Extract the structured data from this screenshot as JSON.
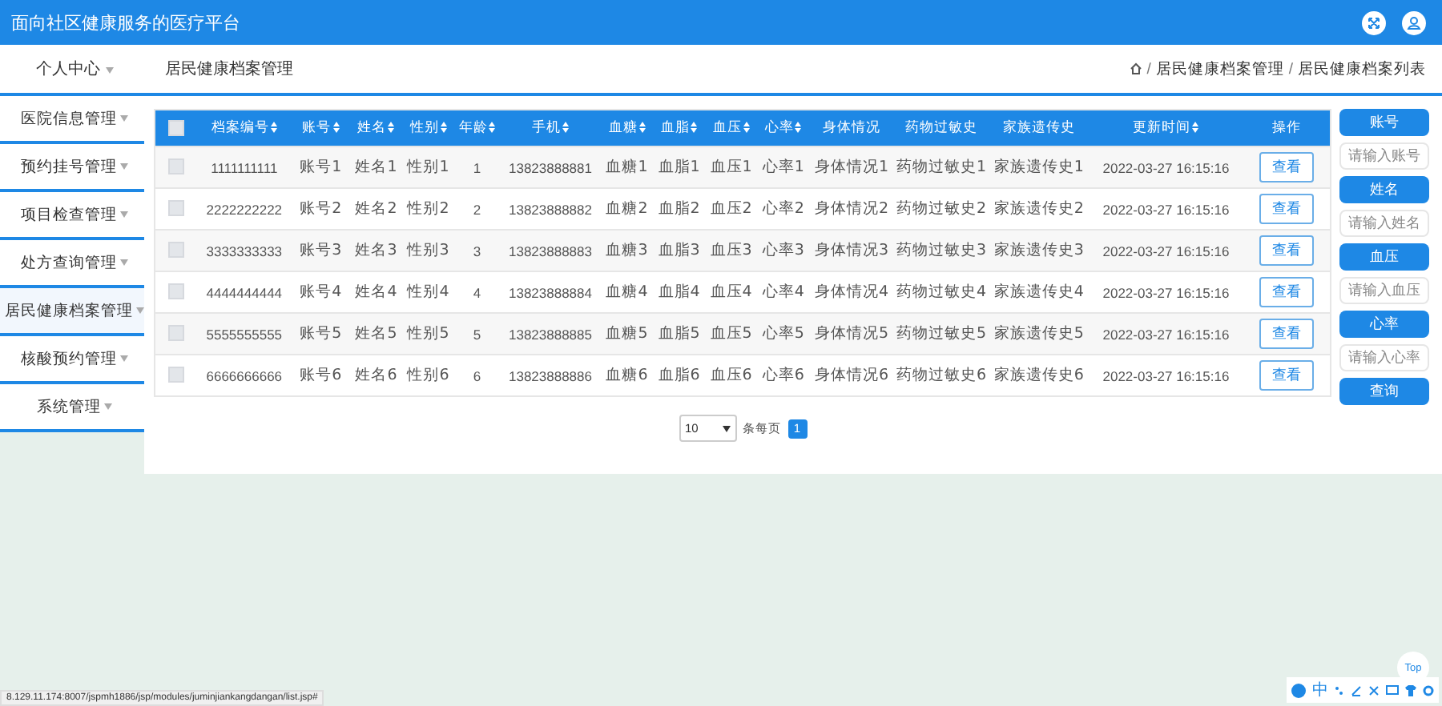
{
  "header": {
    "title": "面向社区健康服务的医疗平台"
  },
  "topbar": {
    "user_menu": "个人中心",
    "page_title": "居民健康档案管理",
    "breadcrumb": [
      {
        "kind": "separator",
        "text": "/"
      },
      {
        "kind": "link",
        "text": "居民健康档案管理"
      },
      {
        "kind": "separator",
        "text": "/"
      },
      {
        "kind": "link",
        "text": "居民健康档案列表"
      }
    ]
  },
  "sidebar": {
    "items": [
      {
        "label": "医院信息管理",
        "hovered": false
      },
      {
        "label": "预约挂号管理",
        "hovered": false
      },
      {
        "label": "项目检查管理",
        "hovered": false
      },
      {
        "label": "处方查询管理",
        "hovered": false
      },
      {
        "label": "居民健康档案管理",
        "hovered": true
      },
      {
        "label": "核酸预约管理",
        "hovered": false
      },
      {
        "label": "系统管理",
        "hovered": false
      }
    ]
  },
  "table": {
    "select_all": {
      "checked": false
    },
    "columns": [
      {
        "label": "档案编号",
        "sortable": true,
        "kind": "number"
      },
      {
        "label": "账号",
        "sortable": true,
        "kind": "text"
      },
      {
        "label": "姓名",
        "sortable": true,
        "kind": "text"
      },
      {
        "label": "性别",
        "sortable": true,
        "kind": "text"
      },
      {
        "label": "年龄",
        "sortable": true,
        "kind": "number"
      },
      {
        "label": "手机",
        "sortable": true,
        "kind": "number"
      },
      {
        "label": "血糖",
        "sortable": true,
        "kind": "text"
      },
      {
        "label": "血脂",
        "sortable": true,
        "kind": "text"
      },
      {
        "label": "血压",
        "sortable": true,
        "kind": "text"
      },
      {
        "label": "心率",
        "sortable": true,
        "kind": "text"
      },
      {
        "label": "身体情况",
        "sortable": false,
        "kind": "text"
      },
      {
        "label": "药物过敏史",
        "sortable": false,
        "kind": "text"
      },
      {
        "label": "家族遗传史",
        "sortable": false,
        "kind": "text"
      },
      {
        "label": "更新时间",
        "sortable": true,
        "kind": "number"
      }
    ],
    "action_column": "操作",
    "rows": [
      {
        "checked": false,
        "cells": [
          "1111111111",
          "账号1",
          "姓名1",
          "性别1",
          "1",
          "13823888881",
          "血糖1",
          "血脂1",
          "血压1",
          "心率1",
          "身体情况1",
          "药物过敏史1",
          "家族遗传史1",
          "2022-03-27 16:15:16"
        ],
        "action": "查看"
      },
      {
        "checked": false,
        "cells": [
          "2222222222",
          "账号2",
          "姓名2",
          "性别2",
          "2",
          "13823888882",
          "血糖2",
          "血脂2",
          "血压2",
          "心率2",
          "身体情况2",
          "药物过敏史2",
          "家族遗传史2",
          "2022-03-27 16:15:16"
        ],
        "action": "查看"
      },
      {
        "checked": false,
        "cells": [
          "3333333333",
          "账号3",
          "姓名3",
          "性别3",
          "3",
          "13823888883",
          "血糖3",
          "血脂3",
          "血压3",
          "心率3",
          "身体情况3",
          "药物过敏史3",
          "家族遗传史3",
          "2022-03-27 16:15:16"
        ],
        "action": "查看"
      },
      {
        "checked": false,
        "cells": [
          "4444444444",
          "账号4",
          "姓名4",
          "性别4",
          "4",
          "13823888884",
          "血糖4",
          "血脂4",
          "血压4",
          "心率4",
          "身体情况4",
          "药物过敏史4",
          "家族遗传史4",
          "2022-03-27 16:15:16"
        ],
        "action": "查看"
      },
      {
        "checked": false,
        "cells": [
          "5555555555",
          "账号5",
          "姓名5",
          "性别5",
          "5",
          "13823888885",
          "血糖5",
          "血脂5",
          "血压5",
          "心率5",
          "身体情况5",
          "药物过敏史5",
          "家族遗传史5",
          "2022-03-27 16:15:16"
        ],
        "action": "查看"
      },
      {
        "checked": false,
        "cells": [
          "6666666666",
          "账号6",
          "姓名6",
          "性别6",
          "6",
          "13823888886",
          "血糖6",
          "血脂6",
          "血压6",
          "心率6",
          "身体情况6",
          "药物过敏史6",
          "家族遗传史6",
          "2022-03-27 16:15:16"
        ],
        "action": "查看"
      }
    ]
  },
  "pagination": {
    "page_size": "10",
    "per_page_label": "条每页",
    "pages": [
      {
        "label": "1",
        "selected": true
      }
    ]
  },
  "search_panel": [
    {
      "kind": "label",
      "text": "账号"
    },
    {
      "kind": "input",
      "placeholder": "请输入账号"
    },
    {
      "kind": "label",
      "text": "姓名"
    },
    {
      "kind": "input",
      "placeholder": "请输入姓名"
    },
    {
      "kind": "label",
      "text": "血压"
    },
    {
      "kind": "input",
      "placeholder": "请输入血压"
    },
    {
      "kind": "label",
      "text": "心率"
    },
    {
      "kind": "input",
      "placeholder": "请输入心率"
    },
    {
      "kind": "button",
      "text": "查询"
    }
  ],
  "status_bar": {
    "url": "8.129.11.174:8007/jspmh1886/jsp/modules/juminjiankangdangan/list.jsp#"
  },
  "back_to_top": "Top",
  "ime_toolbar": {
    "mode": "中"
  }
}
